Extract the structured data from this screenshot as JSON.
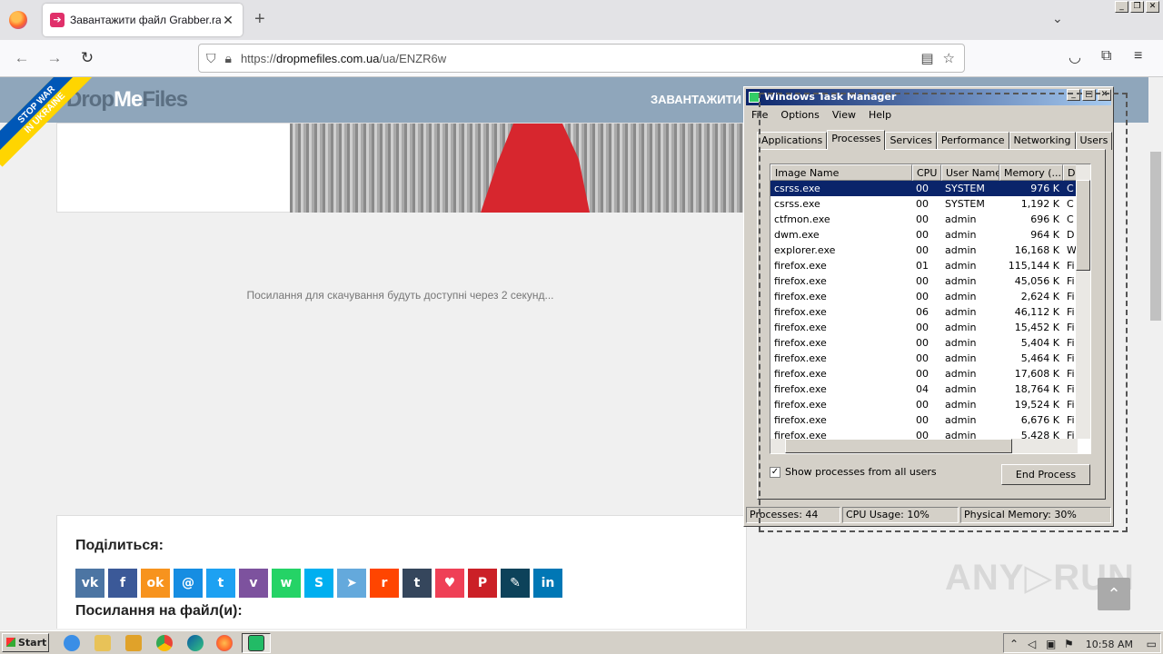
{
  "browser": {
    "tab_title": "Завантажити файл Grabber.rar",
    "url_prefix": "https://",
    "url_domain": "dropmefiles.com.ua",
    "url_path": "/ua/ENZR6w"
  },
  "site": {
    "logo_prefix": "Drop",
    "logo_me": "Me",
    "logo_suffix": "Files",
    "nav_item": "ЗАВАНТАЖИТИ",
    "ribbon_line1": "STOP WAR",
    "ribbon_line2": "IN UKRAINE",
    "wait_message": "Посилання для скачування будуть доступні через 2 секунд...",
    "share_title": "Поділиться:",
    "links_title": "Посилання на файл(и):",
    "share_icons": [
      {
        "name": "vk-icon",
        "glyph": "vk",
        "color": "#4c75a3"
      },
      {
        "name": "facebook-icon",
        "glyph": "f",
        "color": "#3b5998"
      },
      {
        "name": "odnoklassniki-icon",
        "glyph": "ok",
        "color": "#f7931e"
      },
      {
        "name": "moimir-icon",
        "glyph": "@",
        "color": "#168de2"
      },
      {
        "name": "twitter-icon",
        "glyph": "t",
        "color": "#1da1f2"
      },
      {
        "name": "viber-icon",
        "glyph": "v",
        "color": "#7d529e"
      },
      {
        "name": "whatsapp-icon",
        "glyph": "w",
        "color": "#25d366"
      },
      {
        "name": "skype-icon",
        "glyph": "S",
        "color": "#00aff0"
      },
      {
        "name": "telegram-icon",
        "glyph": "➤",
        "color": "#64a9dc"
      },
      {
        "name": "reddit-icon",
        "glyph": "r",
        "color": "#ff4500"
      },
      {
        "name": "tumblr-icon",
        "glyph": "t",
        "color": "#35465c"
      },
      {
        "name": "pocket-icon",
        "glyph": "♥",
        "color": "#ef4056"
      },
      {
        "name": "pinterest-icon",
        "glyph": "P",
        "color": "#cb2027"
      },
      {
        "name": "livejournal-icon",
        "glyph": "✎",
        "color": "#0d425a"
      },
      {
        "name": "linkedin-icon",
        "glyph": "in",
        "color": "#0077b5"
      }
    ],
    "watermark": "ANY▷RUN"
  },
  "task_manager": {
    "title": "Windows Task Manager",
    "menu": [
      "File",
      "Options",
      "View",
      "Help"
    ],
    "tabs": [
      "Applications",
      "Processes",
      "Services",
      "Performance",
      "Networking",
      "Users"
    ],
    "active_tab": "Processes",
    "columns": [
      "Image Name",
      "CPU",
      "User Name",
      "Memory (...",
      "D"
    ],
    "rows": [
      {
        "name": "csrss.exe",
        "cpu": "00",
        "user": "SYSTEM",
        "mem": "976 K",
        "d": "C",
        "selected": true
      },
      {
        "name": "csrss.exe",
        "cpu": "00",
        "user": "SYSTEM",
        "mem": "1,192 K",
        "d": "C"
      },
      {
        "name": "ctfmon.exe",
        "cpu": "00",
        "user": "admin",
        "mem": "696 K",
        "d": "C"
      },
      {
        "name": "dwm.exe",
        "cpu": "00",
        "user": "admin",
        "mem": "964 K",
        "d": "D"
      },
      {
        "name": "explorer.exe",
        "cpu": "00",
        "user": "admin",
        "mem": "16,168 K",
        "d": "W"
      },
      {
        "name": "firefox.exe",
        "cpu": "01",
        "user": "admin",
        "mem": "115,144 K",
        "d": "Fi"
      },
      {
        "name": "firefox.exe",
        "cpu": "00",
        "user": "admin",
        "mem": "45,056 K",
        "d": "Fi"
      },
      {
        "name": "firefox.exe",
        "cpu": "00",
        "user": "admin",
        "mem": "2,624 K",
        "d": "Fi"
      },
      {
        "name": "firefox.exe",
        "cpu": "06",
        "user": "admin",
        "mem": "46,112 K",
        "d": "Fi"
      },
      {
        "name": "firefox.exe",
        "cpu": "00",
        "user": "admin",
        "mem": "15,452 K",
        "d": "Fi"
      },
      {
        "name": "firefox.exe",
        "cpu": "00",
        "user": "admin",
        "mem": "5,404 K",
        "d": "Fi"
      },
      {
        "name": "firefox.exe",
        "cpu": "00",
        "user": "admin",
        "mem": "5,464 K",
        "d": "Fi"
      },
      {
        "name": "firefox.exe",
        "cpu": "00",
        "user": "admin",
        "mem": "17,608 K",
        "d": "Fi"
      },
      {
        "name": "firefox.exe",
        "cpu": "04",
        "user": "admin",
        "mem": "18,764 K",
        "d": "Fi"
      },
      {
        "name": "firefox.exe",
        "cpu": "00",
        "user": "admin",
        "mem": "19,524 K",
        "d": "Fi"
      },
      {
        "name": "firefox.exe",
        "cpu": "00",
        "user": "admin",
        "mem": "6,676 K",
        "d": "Fi"
      },
      {
        "name": "firefox.exe",
        "cpu": "00",
        "user": "admin",
        "mem": "5,428 K",
        "d": "Fi"
      }
    ],
    "show_all_label": "Show processes from all users",
    "show_all_checked": true,
    "end_process_label": "End Process",
    "status_processes": "Processes: 44",
    "status_cpu": "CPU Usage: 10%",
    "status_memory": "Physical Memory: 30%"
  },
  "taskbar": {
    "start_label": "Start",
    "clock": "10:58 AM"
  }
}
